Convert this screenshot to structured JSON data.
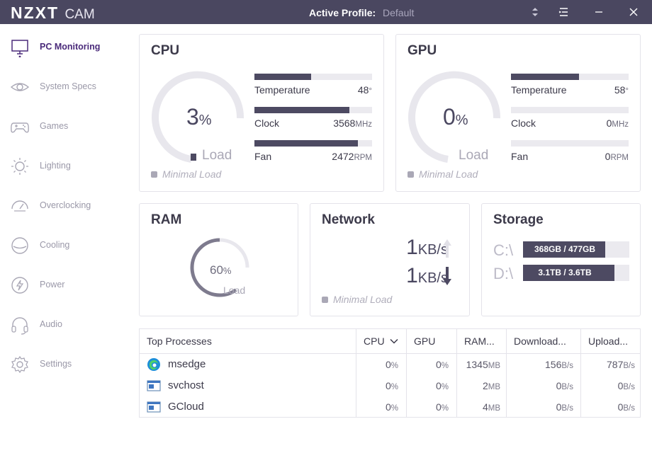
{
  "app": {
    "brand": "NZXT",
    "brand_suffix": "CAM"
  },
  "titlebar": {
    "profile_label": "Active Profile:",
    "profile_value": "Default"
  },
  "sidebar": {
    "items": [
      {
        "label": "PC Monitoring",
        "icon": "monitor-icon",
        "active": true
      },
      {
        "label": "System Specs",
        "icon": "eye-icon"
      },
      {
        "label": "Games",
        "icon": "gamepad-icon"
      },
      {
        "label": "Lighting",
        "icon": "sun-icon"
      },
      {
        "label": "Overclocking",
        "icon": "speedometer-icon"
      },
      {
        "label": "Cooling",
        "icon": "cooling-icon"
      },
      {
        "label": "Power",
        "icon": "power-bolt-icon"
      },
      {
        "label": "Audio",
        "icon": "headphones-icon"
      },
      {
        "label": "Settings",
        "icon": "gear-icon"
      }
    ]
  },
  "cpu": {
    "title": "CPU",
    "load_value": "3",
    "load_unit": "%",
    "load_label": "Load",
    "status": "Minimal Load",
    "metrics": [
      {
        "name": "Temperature",
        "value": "48",
        "unit": "°",
        "fill": 0.48
      },
      {
        "name": "Clock",
        "value": "3568",
        "unit": "MHz",
        "fill": 0.81
      },
      {
        "name": "Fan",
        "value": "2472",
        "unit": "RPM",
        "fill": 0.88
      }
    ]
  },
  "gpu": {
    "title": "GPU",
    "load_value": "0",
    "load_unit": "%",
    "load_label": "Load",
    "status": "Minimal Load",
    "metrics": [
      {
        "name": "Temperature",
        "value": "58",
        "unit": "°",
        "fill": 0.58
      },
      {
        "name": "Clock",
        "value": "0",
        "unit": "MHz",
        "fill": 0
      },
      {
        "name": "Fan",
        "value": "0",
        "unit": "RPM",
        "fill": 0
      }
    ]
  },
  "ram": {
    "title": "RAM",
    "value": "60",
    "unit": "%",
    "load_label": "Load"
  },
  "network": {
    "title": "Network",
    "status": "Minimal Load",
    "upload_value": "1",
    "upload_unit": "KB/s",
    "download_value": "1",
    "download_unit": "KB/s"
  },
  "storage": {
    "title": "Storage",
    "drives": [
      {
        "letter": "C:\\",
        "usage": "368GB / 477GB",
        "fill": 0.77
      },
      {
        "letter": "D:\\",
        "usage": "3.1TB / 3.6TB",
        "fill": 0.86
      }
    ]
  },
  "processes": {
    "headers": {
      "name": "Top Processes",
      "cpu": "CPU",
      "gpu": "GPU",
      "ram": "RAM...",
      "download": "Download...",
      "upload": "Upload..."
    },
    "rows": [
      {
        "name": "msedge",
        "icon": "edge-icon",
        "cpu": "0",
        "gpu": "0",
        "ram": "1345",
        "download": "156",
        "upload": "787"
      },
      {
        "name": "svchost",
        "icon": "window-app-icon",
        "cpu": "0",
        "gpu": "0",
        "ram": "2",
        "download": "0",
        "upload": "0"
      },
      {
        "name": "GCloud",
        "icon": "window-app-icon",
        "cpu": "0",
        "gpu": "0",
        "ram": "4",
        "download": "0",
        "upload": "0"
      }
    ],
    "units": {
      "percent": "%",
      "ram": "MB",
      "rate": "B/s"
    }
  },
  "colors": {
    "titlebar": "#4a4760",
    "accent": "#4a2a7a",
    "bar_fill": "#4d4a62",
    "bar_track": "#ebeaef"
  }
}
